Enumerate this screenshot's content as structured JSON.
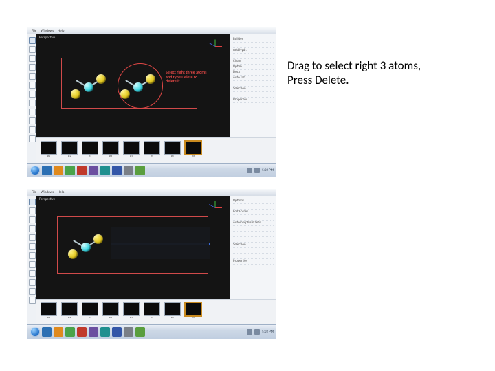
{
  "caption": {
    "line1": "Drag to select right 3 atoms,",
    "line2": "Press Delete."
  },
  "menubar": {
    "items": [
      "File",
      "Windows",
      "Help"
    ]
  },
  "viewport_title": "Perspective",
  "prop_panel": {
    "rows_a": [
      "Builder",
      "",
      "Add Hydr.",
      "",
      "Clean",
      "Optim.",
      "Dock",
      "Auto rot.",
      "",
      "Selection",
      "",
      "Properties"
    ],
    "rows_b": [
      "Options",
      "",
      "Edit Forces",
      "",
      "Automorphism Sets",
      "",
      "",
      "",
      "Selection",
      "",
      "",
      "Properties"
    ]
  },
  "overlay_text_a": "Select right three atoms and type Delete to delete it.",
  "thumbs": {
    "labels": [
      "sf1",
      "sf2",
      "sf3",
      "sf4",
      "sf5",
      "sf6",
      "sf7",
      "sf8"
    ],
    "selected_index": 7
  },
  "taskbar": {
    "clock": "5:02 PM"
  }
}
